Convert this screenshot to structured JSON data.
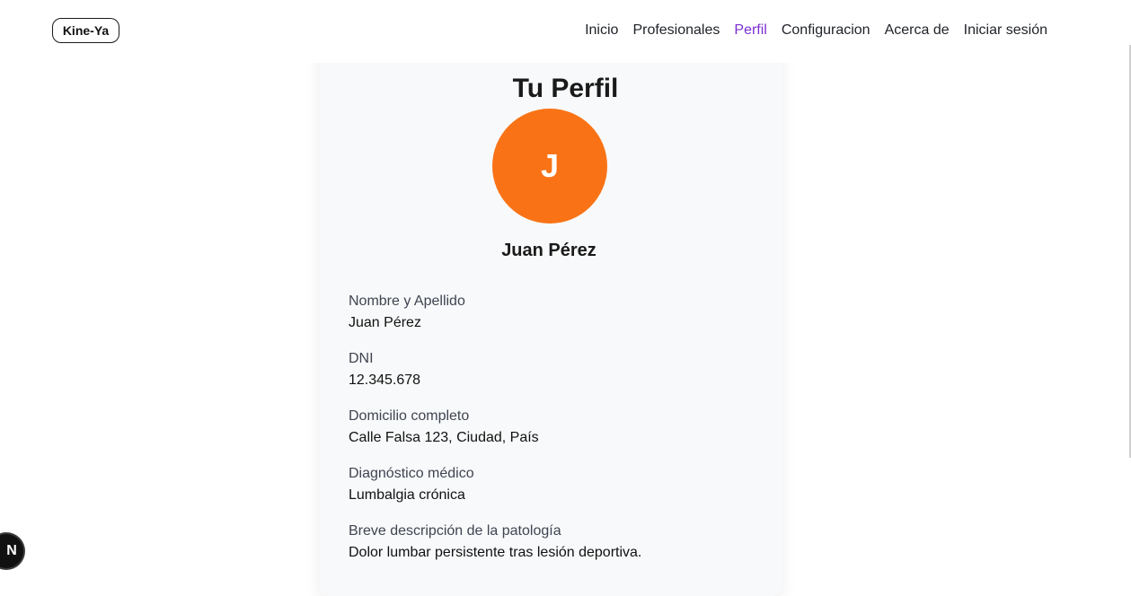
{
  "header": {
    "logo": "Kine-Ya",
    "nav": [
      "Inicio",
      "Profesionales",
      "Perfil",
      "Configuracion",
      "Acerca de",
      "Iniciar sesión"
    ]
  },
  "profile": {
    "title": "Tu Perfil",
    "avatar_initial": "J",
    "display_name": "Juan Pérez",
    "fields": [
      {
        "label": "Nombre y Apellido",
        "value": "Juan Pérez"
      },
      {
        "label": "DNI",
        "value": "12.345.678"
      },
      {
        "label": "Domicilio completo",
        "value": "Calle Falsa 123, Ciudad, País"
      },
      {
        "label": "Diagnóstico médico",
        "value": "Lumbalgia crónica"
      },
      {
        "label": "Breve descripción de la patología",
        "value": "Dolor lumbar persistente tras lesión deportiva."
      }
    ]
  },
  "devtools": {
    "label": "N"
  },
  "colors": {
    "active_nav": "#7b2fd0",
    "avatar_bg": "#f97316"
  }
}
